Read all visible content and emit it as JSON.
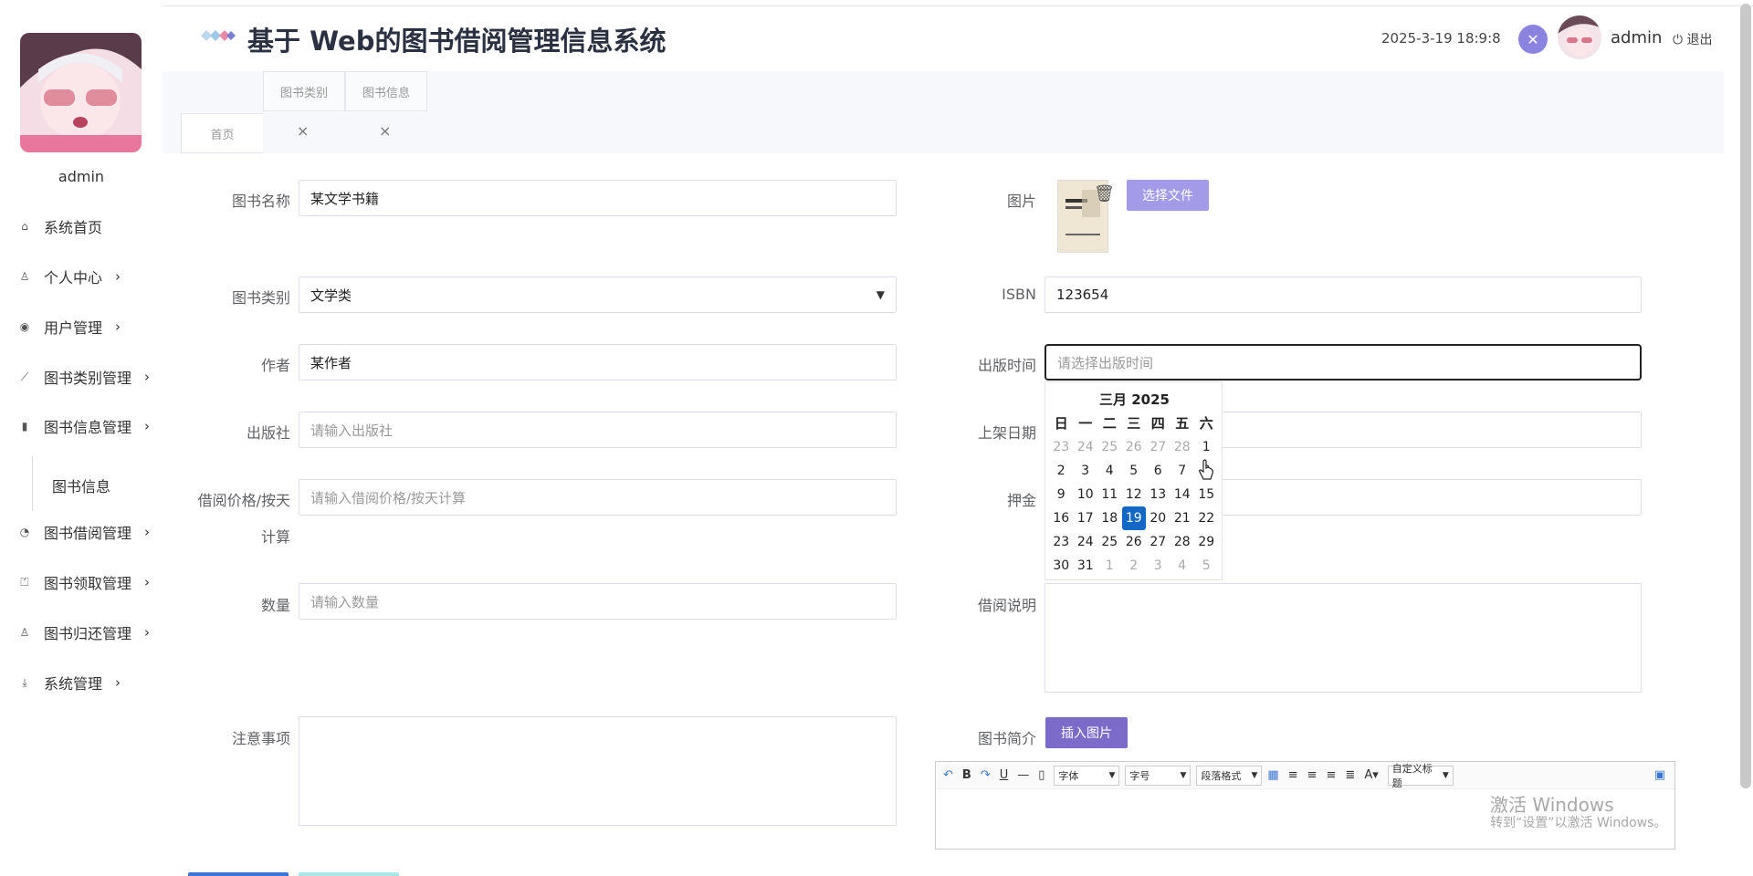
{
  "app": {
    "title": "基于 Web的图书借阅管理信息系统"
  },
  "header": {
    "datetime": "2025-3-19 18:9:8",
    "username": "admin",
    "logout_label": "退出"
  },
  "sidebar": {
    "username": "admin",
    "items": [
      {
        "label": "系统首页",
        "icon": "home-icon"
      },
      {
        "label": "个人中心",
        "icon": "user-icon"
      },
      {
        "label": "用户管理",
        "icon": "target-icon"
      },
      {
        "label": "图书类别管理",
        "icon": "chart-line-icon"
      },
      {
        "label": "图书信息管理",
        "icon": "bar-chart-icon"
      },
      {
        "label": "图书借阅管理",
        "icon": "gauge-icon"
      },
      {
        "label": "图书领取管理",
        "icon": "thumbs-up-icon"
      },
      {
        "label": "图书归还管理",
        "icon": "user-return-icon"
      },
      {
        "label": "系统管理",
        "icon": "download-icon"
      }
    ],
    "subitem": "图书信息"
  },
  "tabs": {
    "home": "首页",
    "category": "图书类别",
    "info": "图书信息"
  },
  "form": {
    "name_label": "图书名称",
    "name_value": "某文学书籍",
    "category_label": "图书类别",
    "category_value": "文学类",
    "author_label": "作者",
    "author_value": "某作者",
    "publisher_label": "出版社",
    "publisher_placeholder": "请输入出版社",
    "price_label_1": "借阅价格/按天",
    "price_label_2": "计算",
    "price_placeholder": "请输入借阅价格/按天计算",
    "qty_label": "数量",
    "qty_placeholder": "请输入数量",
    "notes_label": "注意事项",
    "image_label": "图片",
    "choose_file": "选择文件",
    "isbn_label": "ISBN",
    "isbn_value": "123654",
    "pubdate_label": "出版时间",
    "pubdate_placeholder": "请选择出版时间",
    "shelf_label": "上架日期",
    "deposit_label": "押金",
    "borrow_desc_label": "借阅说明",
    "intro_label": "图书简介",
    "insert_image": "插入图片"
  },
  "datepicker": {
    "header": "三月 2025",
    "weekdays": [
      "日",
      "一",
      "二",
      "三",
      "四",
      "五",
      "六"
    ],
    "weeks": [
      [
        "23",
        "24",
        "25",
        "26",
        "27",
        "28",
        "1"
      ],
      [
        "2",
        "3",
        "4",
        "5",
        "6",
        "7",
        "8"
      ],
      [
        "9",
        "10",
        "11",
        "12",
        "13",
        "14",
        "15"
      ],
      [
        "16",
        "17",
        "18",
        "19",
        "20",
        "21",
        "22"
      ],
      [
        "23",
        "24",
        "25",
        "26",
        "27",
        "28",
        "29"
      ],
      [
        "30",
        "31",
        "1",
        "2",
        "3",
        "4",
        "5"
      ]
    ],
    "selected": "19"
  },
  "editor": {
    "font_label": "字体",
    "size_label": "字号",
    "paragraph_label": "段落格式",
    "custom_title_label": "自定义标题",
    "buttons": [
      "↶",
      "B",
      "↷",
      "U",
      "—",
      "▯"
    ]
  },
  "watermark": {
    "line1": "激活 Windows",
    "line2": "转到“设置”以激活 Windows。"
  },
  "colors": {
    "accent": "#8a84e0",
    "selected_day": "#1268c4",
    "insert_button": "#7d6bc9",
    "file_button": "#a49be8"
  }
}
